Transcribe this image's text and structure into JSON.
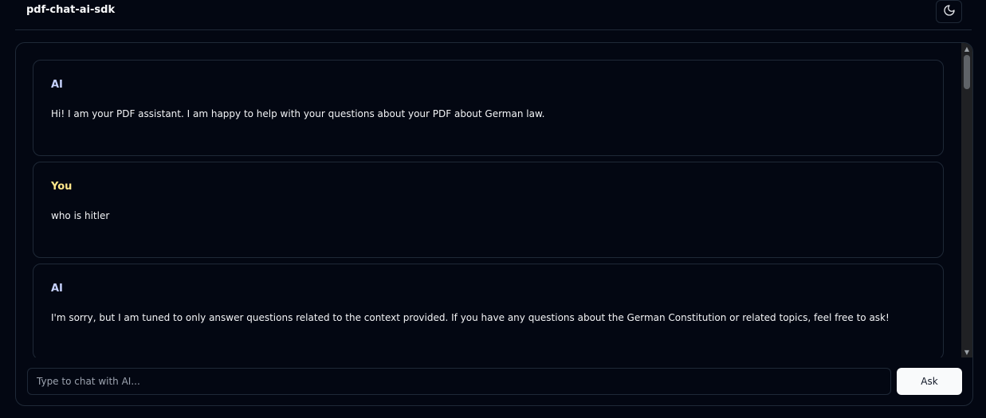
{
  "header": {
    "title": "pdf-chat-ai-sdk",
    "theme_toggle_icon": "moon-icon"
  },
  "messages": [
    {
      "role": "AI",
      "text": "Hi! I am your PDF assistant. I am happy to help with your questions about your PDF about German law."
    },
    {
      "role": "You",
      "text": "who is hitler"
    },
    {
      "role": "AI",
      "text": "I'm sorry, but I am tuned to only answer questions related to the context provided. If you have any questions about the German Constitution or related topics, feel free to ask!"
    }
  ],
  "input": {
    "placeholder": "Type to chat with AI...",
    "value": ""
  },
  "ask_button": {
    "label": "Ask"
  },
  "colors": {
    "background": "#030712",
    "border": "#1f2937",
    "ai_role": "#c7d2fe",
    "user_role": "#fde68a",
    "button_bg": "#f9fafb"
  }
}
